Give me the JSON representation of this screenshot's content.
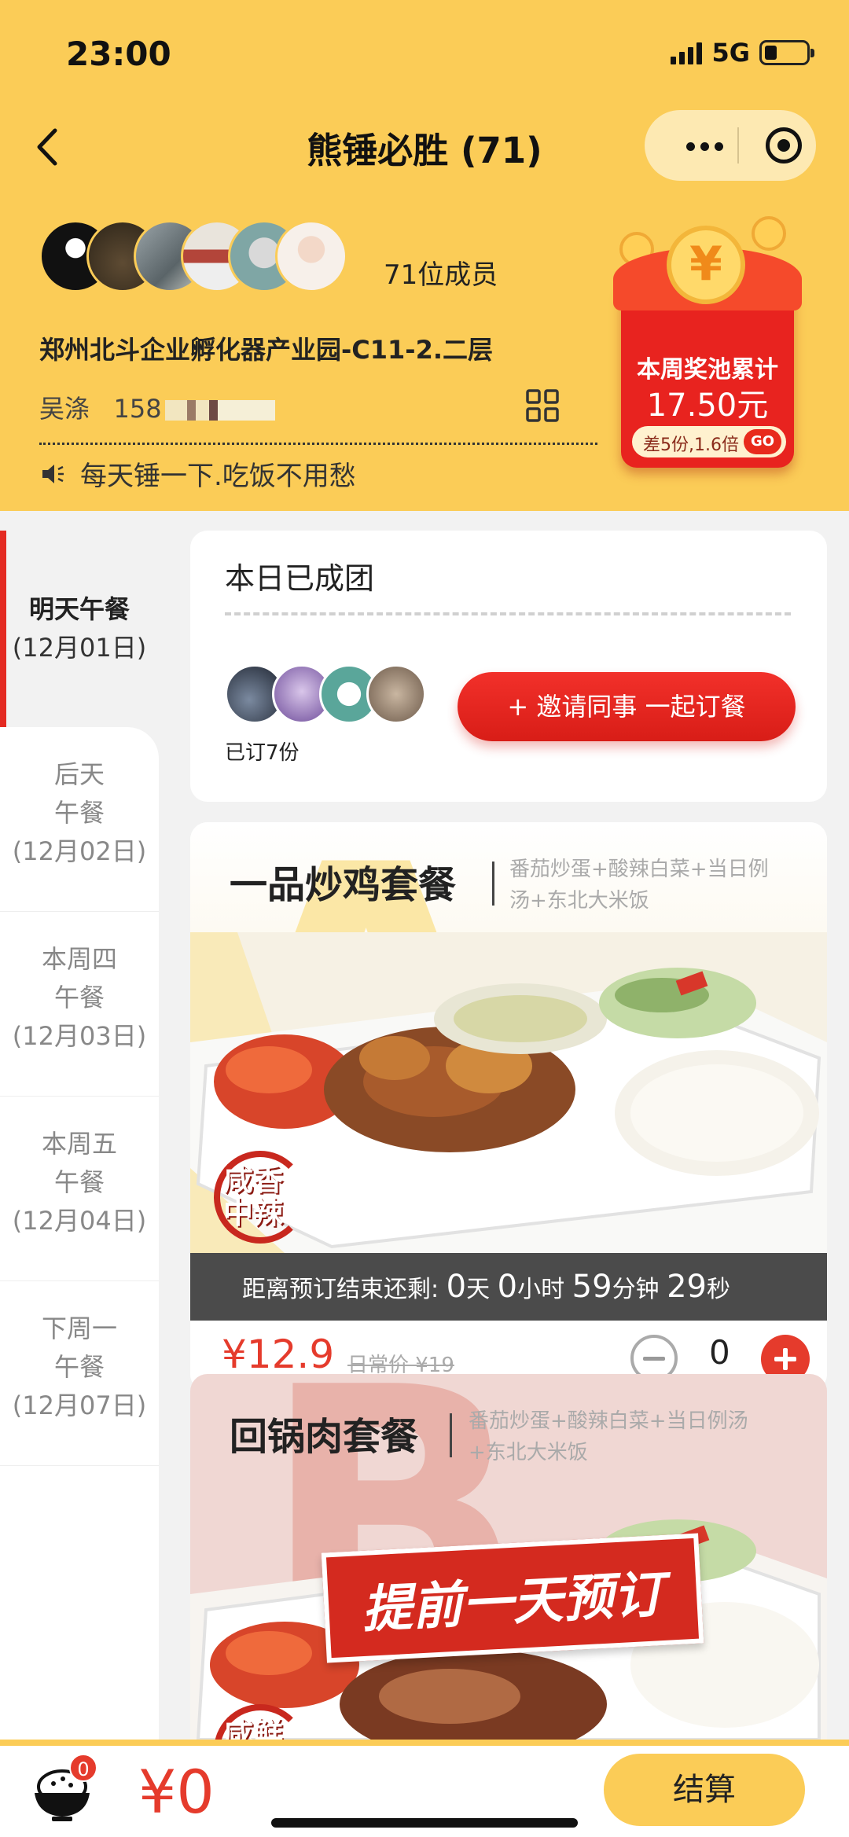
{
  "status": {
    "time": "23:00",
    "network": "5G"
  },
  "header": {
    "title": "熊锤必胜 (71)",
    "member_count": "71位成员",
    "address": "郑州北斗企业孵化器产业园-C11-2.二层",
    "contact_name": "吴涤",
    "contact_phone": "158",
    "notice": "每天锤一下.吃饭不用愁"
  },
  "reward": {
    "title": "本周奖池累计",
    "amount": "17.50元",
    "note": "差5份,1.6倍",
    "go": "GO"
  },
  "sidebar": {
    "items": [
      {
        "main": "明天午餐",
        "date": "(12月01日)"
      },
      {
        "line1": "后天",
        "line2": "午餐",
        "date": "(12月02日)"
      },
      {
        "line1": "本周四",
        "line2": "午餐",
        "date": "(12月03日)"
      },
      {
        "line1": "本周五",
        "line2": "午餐",
        "date": "(12月04日)"
      },
      {
        "line1": "下周一",
        "line2": "午餐",
        "date": "(12月07日)"
      }
    ]
  },
  "group": {
    "title": "本日已成团",
    "ordered": "已订7份",
    "invite_label": "+ 邀请同事 一起订餐"
  },
  "meals": [
    {
      "name": "一品炒鸡套餐",
      "desc_line1": "番茄炒蛋+酸辣白菜+当日例",
      "desc_line2": "汤+东北大米饭",
      "tag": "咸香中辣",
      "tag_line1": "咸香",
      "tag_line2": "中辣",
      "countdown_prefix": "距离预订结束还剩:",
      "cd_days": "0",
      "cd_days_unit": "天",
      "cd_hours": "0",
      "cd_hours_unit": "小时",
      "cd_mins": "59",
      "cd_mins_unit": "分钟",
      "cd_secs": "29",
      "cd_secs_unit": "秒",
      "price": "¥12.9",
      "regular_price": "日常价 ¥19",
      "quantity": "0"
    },
    {
      "name": "回锅肉套餐",
      "desc_line1": "番茄炒蛋+酸辣白菜+当日例汤",
      "desc_line2": "+东北大米饭",
      "banner": "提前一天预订",
      "tag_line1": "咸鲜"
    }
  ],
  "cart": {
    "badge": "0",
    "total": "¥0",
    "checkout_label": "结算"
  },
  "colors": {
    "brand_yellow": "#fbcc57",
    "accent_red": "#e53b2c"
  }
}
